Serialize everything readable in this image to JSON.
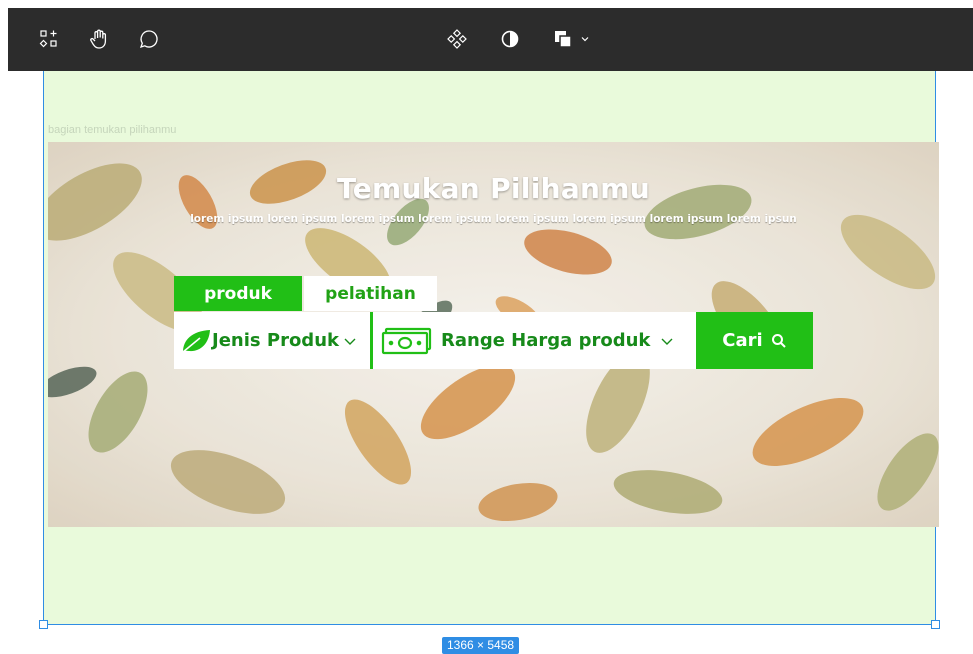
{
  "toolbar": {
    "left_tools": [
      "shapes-icon",
      "hand-icon",
      "comment-icon"
    ],
    "center_tools": [
      "component-icon",
      "contrast-icon",
      "layers-icon",
      "chevron-down-icon"
    ]
  },
  "canvas": {
    "frame_label": "bagian temukan pilihanmu",
    "size_badge": "1366 × 5458",
    "colors": {
      "frame_bg": "#e9fadb",
      "selection": "#2f8de4"
    }
  },
  "hero": {
    "title": "Temukan Pilihanmu",
    "subtitle": "lorem  ipsum loren ipsum lorem ipsum lorem ipsum lorem ipsum lorem ipsum lorem ipsum lorem ipsun",
    "tabs": [
      {
        "label": "produk",
        "active": true
      },
      {
        "label": "pelatihan",
        "active": false
      }
    ],
    "search": {
      "jenis_label": "Jenis Produk",
      "harga_label": "Range Harga produk",
      "button_label": "Cari"
    },
    "colors": {
      "accent": "#21bf16",
      "text_green": "#178a1a"
    }
  }
}
